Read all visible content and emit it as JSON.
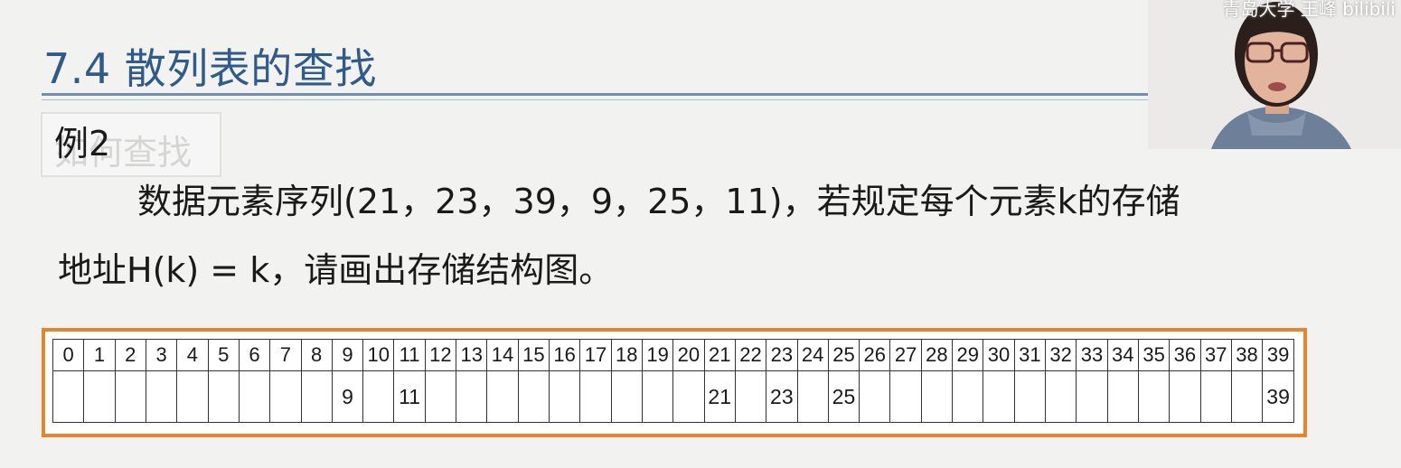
{
  "slide": {
    "title": "7.4 散列表的查找",
    "ghost_label": "如何查找",
    "example_label": "例2",
    "problem_line1": "数据元素序列(21，23，39，9，25，11)，若规定每个元素k的存储",
    "problem_line2": "地址H(k) = k，请画出存储结构图。"
  },
  "hash_table": {
    "addresses": [
      "0",
      "1",
      "2",
      "3",
      "4",
      "5",
      "6",
      "7",
      "8",
      "9",
      "10",
      "11",
      "12",
      "13",
      "14",
      "15",
      "16",
      "17",
      "18",
      "19",
      "20",
      "21",
      "22",
      "23",
      "24",
      "25",
      "26",
      "27",
      "28",
      "29",
      "30",
      "31",
      "32",
      "33",
      "34",
      "35",
      "36",
      "37",
      "38",
      "39"
    ],
    "values": [
      "",
      "",
      "",
      "",
      "",
      "",
      "",
      "",
      "",
      "9",
      "",
      "11",
      "",
      "",
      "",
      "",
      "",
      "",
      "",
      "",
      "",
      "21",
      "",
      "23",
      "",
      "25",
      "",
      "",
      "",
      "",
      "",
      "",
      "",
      "",
      "",
      "",
      "",
      "",
      "",
      "39"
    ]
  },
  "webcam": {
    "caption": "青岛大学 王峰 bilibili"
  },
  "colors": {
    "title": "#2f5b8c",
    "frame_border": "#e8832e",
    "background": "#f2f2f1"
  }
}
